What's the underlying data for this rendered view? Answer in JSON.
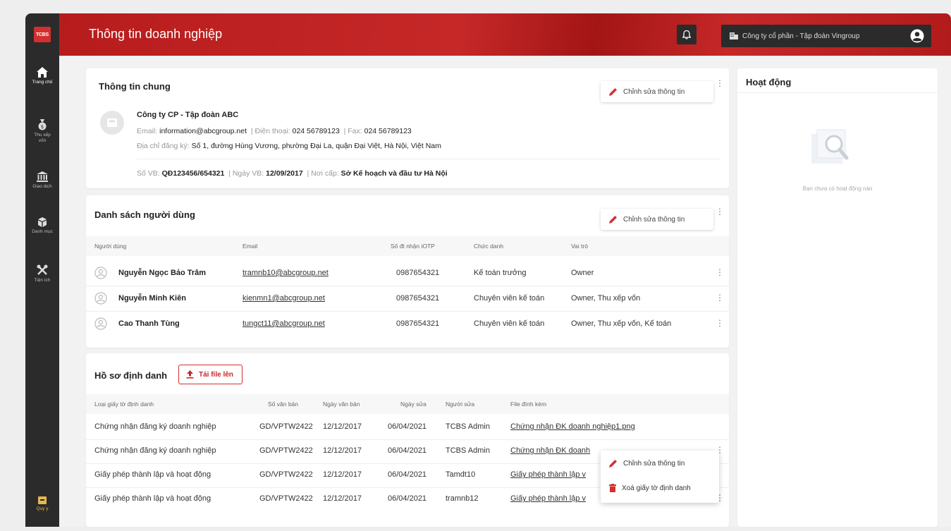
{
  "sidebar": {
    "logo": "TCBS",
    "items": [
      {
        "label": "Trang chủ",
        "icon": "home-icon"
      },
      {
        "label": "Thu xếp vốn",
        "icon": "money-bag-icon"
      },
      {
        "label": "Giao dịch",
        "icon": "bank-icon"
      },
      {
        "label": "Danh mục",
        "icon": "portfolio-icon"
      },
      {
        "label": "Tiện ích",
        "icon": "tools-icon"
      }
    ],
    "bottom_item": {
      "label": "Quy y",
      "icon": "folder-icon"
    }
  },
  "header": {
    "title": "Thông tin doanh nghiệp",
    "company": "Công ty cổ phần - Tập đoàn Vingroup"
  },
  "general": {
    "title": "Thông tin chung",
    "edit_label": "Chỉnh sửa thông tin",
    "company_name": "Công ty CP - Tập đoàn ABC",
    "email_label": "Email:",
    "email": "information@abcgroup.net",
    "phone_label": "Điện thoại:",
    "phone": "024 56789123",
    "fax_label": "Fax:",
    "fax": "024 56789123",
    "address_label": "Địa chỉ đăng ký:",
    "address": "Số 1, đường Hùng Vương, phường Đại La, quận Đại Việt, Hà Nội, Việt Nam",
    "doc_no_label": "Số VB:",
    "doc_no": "QĐ123456/654321",
    "doc_date_label": "Ngày VB:",
    "doc_date": "12/09/2017",
    "issuer_label": "Nơi cấp:",
    "issuer": "Sở Kế hoạch và đầu tư Hà Nội"
  },
  "users": {
    "title": "Danh sách người dùng",
    "edit_label": "Chỉnh sửa thông tin",
    "columns": [
      "Người dùng",
      "Email",
      "Số đt nhận iOTP",
      "Chức danh",
      "Vai trò"
    ],
    "rows": [
      {
        "name": "Nguyễn Ngọc Bảo Trâm",
        "email": "tramnb10@abcgroup.net",
        "phone": "0987654321",
        "position": "Kế toán trưởng",
        "role": "Owner"
      },
      {
        "name": "Nguyễn Minh Kiên",
        "email": "kienmn1@abcgroup.net",
        "phone": "0987654321",
        "position": "Chuyên viên kế toán",
        "role": "Owner, Thu xếp vốn"
      },
      {
        "name": "Cao Thanh Tùng",
        "email": "tungct11@abcgroup.net",
        "phone": "0987654321",
        "position": "Chuyên viên kế toán",
        "role": "Owner, Thu xếp vốn, Kế toán"
      }
    ]
  },
  "identity": {
    "title": "Hồ sơ định danh",
    "upload_label": "Tải file lên",
    "columns": [
      "Loại giấy tờ định danh",
      "Số văn bản",
      "Ngày văn bản",
      "Ngày sửa",
      "Người sửa",
      "File đính kèm"
    ],
    "rows": [
      {
        "type": "Chứng nhận đăng ký doanh nghiệp",
        "no": "GD/VPTW2422",
        "date": "12/12/2017",
        "edited": "06/04/2021",
        "editor": "TCBS Admin",
        "file": "Chứng nhận ĐK doanh nghiệp1.png"
      },
      {
        "type": "Chứng nhận đăng ký doanh nghiệp",
        "no": "GD/VPTW2422",
        "date": "12/12/2017",
        "edited": "06/04/2021",
        "editor": "TCBS Admin",
        "file": "Chứng nhận ĐK doanh"
      },
      {
        "type": "Giấy phép thành lập và hoạt động",
        "no": "GD/VPTW2422",
        "date": "12/12/2017",
        "edited": "06/04/2021",
        "editor": "Tamdt10",
        "file": "Giấy phép thành lập v"
      },
      {
        "type": "Giấy phép thành lập và hoạt động",
        "no": "GD/VPTW2422",
        "date": "12/12/2017",
        "edited": "06/04/2021",
        "editor": "tramnb12",
        "file": "Giấy phép thành lập v"
      }
    ],
    "context_menu": {
      "edit": "Chỉnh sửa thông tin",
      "delete": "Xoá giấy tờ định danh"
    }
  },
  "activity": {
    "title": "Hoạt động",
    "empty": "Bạn chưa có hoạt động nào"
  },
  "colors": {
    "brand": "#c62828",
    "sidebar": "#2b2b2b",
    "link": "#1976d2"
  }
}
